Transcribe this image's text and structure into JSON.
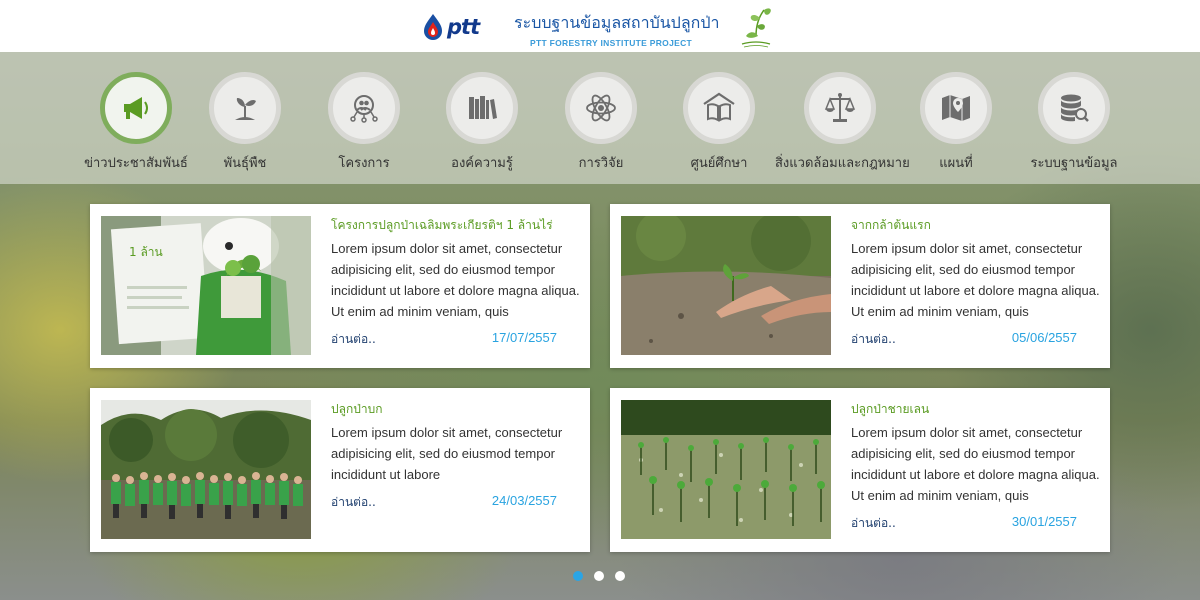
{
  "header": {
    "brand": "ptt",
    "title": "ระบบฐานข้อมูลสถาบันปลูกป่า",
    "subtitle": "PTT FORESTRY INSTITUTE PROJECT"
  },
  "nav": {
    "items": [
      {
        "label": "ข่าวประชาสัมพันธ์",
        "icon": "megaphone-icon",
        "active": true
      },
      {
        "label": "พันธุ์พืช",
        "icon": "sprout-icon"
      },
      {
        "label": "โครงการ",
        "icon": "people-network-icon"
      },
      {
        "label": "องค์ความรู้",
        "icon": "books-icon"
      },
      {
        "label": "การวิจัย",
        "icon": "atom-icon"
      },
      {
        "label": "ศูนย์ศึกษา",
        "icon": "book-house-icon"
      },
      {
        "label": "สิ่งแวดล้อมและกฎหมาย",
        "icon": "scales-icon"
      },
      {
        "label": "แผนที่",
        "icon": "map-pin-icon"
      },
      {
        "label": "ระบบฐานข้อมูล",
        "icon": "database-search-icon"
      }
    ]
  },
  "news": [
    {
      "title": "โครงการปลูกป่าเฉลิมพระเกียรติฯ 1 ล้านไร่",
      "text": "Lorem ipsum dolor sit amet, consectetur adipisicing elit, sed do eiusmod tempor incididunt ut labore et dolore magna aliqua. Ut enim ad minim veniam, quis",
      "read_more": "อ่านต่อ..",
      "date": "17/07/2557"
    },
    {
      "title": "จากกล้าต้นแรก",
      "text": "Lorem ipsum dolor sit amet, consectetur adipisicing elit, sed do eiusmod tempor incididunt ut labore et dolore magna aliqua. Ut enim ad minim veniam, quis",
      "read_more": "อ่านต่อ..",
      "date": "05/06/2557"
    },
    {
      "title": "ปลูกป่าบก",
      "text": "Lorem ipsum dolor sit amet, consectetur adipisicing elit, sed do eiusmod tempor incididunt ut labore",
      "read_more": "อ่านต่อ..",
      "date": "24/03/2557"
    },
    {
      "title": "ปลูกป่าชายเลน",
      "text": "Lorem ipsum dolor sit amet, consectetur adipisicing elit, sed do eiusmod tempor incididunt ut labore et dolore magna aliqua. Ut enim ad minim veniam, quis",
      "read_more": "อ่านต่อ..",
      "date": "30/01/2557"
    }
  ],
  "pager": {
    "pages": 3,
    "current": 1
  },
  "colors": {
    "accent_green": "#5a9b22",
    "date_blue": "#29a3e0",
    "active_dot": "#2aa5e6",
    "brand_blue": "#1a56a5"
  }
}
